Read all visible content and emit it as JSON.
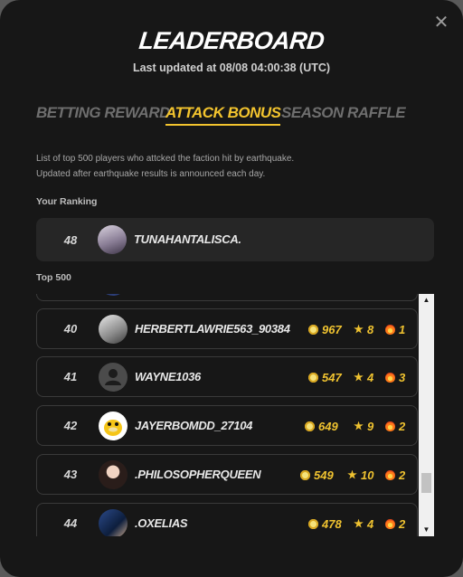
{
  "modal": {
    "title": "LEADERBOARD",
    "last_updated": "Last updated at 08/08 04:00:38 (UTC)",
    "close_icon": "close-icon"
  },
  "tabs": [
    {
      "label": "BETTING REWARD",
      "active": false
    },
    {
      "label": "ATTACK BONUS",
      "active": true
    },
    {
      "label": "SEASON RAFFLE",
      "active": false
    }
  ],
  "description": {
    "line1": "List of top 500 players who attcked the faction hit by earthquake.",
    "line2": "Updated after earthquake results is announced each day."
  },
  "your_ranking": {
    "label": "Your Ranking",
    "rank": "48",
    "username": "TUNAHANTALISCA."
  },
  "top500": {
    "label": "Top 500",
    "rows": [
      {
        "rank": "40",
        "username": "HERBERTLAWRIE563_90384",
        "gems": "967",
        "stars": "8",
        "fires": "1",
        "avatar": "photo"
      },
      {
        "rank": "41",
        "username": "WAYNE1036",
        "gems": "547",
        "stars": "4",
        "fires": "3",
        "avatar": "default"
      },
      {
        "rank": "42",
        "username": "JAYERBOMDD_27104",
        "gems": "649",
        "stars": "9",
        "fires": "2",
        "avatar": "duck"
      },
      {
        "rank": "43",
        "username": ".PHILOSOPHERQUEEN",
        "gems": "549",
        "stars": "10",
        "fires": "2",
        "avatar": "photo"
      },
      {
        "rank": "44",
        "username": ".OXELIAS",
        "gems": "478",
        "stars": "4",
        "fires": "2",
        "avatar": "photo"
      }
    ]
  },
  "colors": {
    "accent": "#f3c42e",
    "background": "#171717",
    "inactive_tab": "#6e6e6e"
  }
}
